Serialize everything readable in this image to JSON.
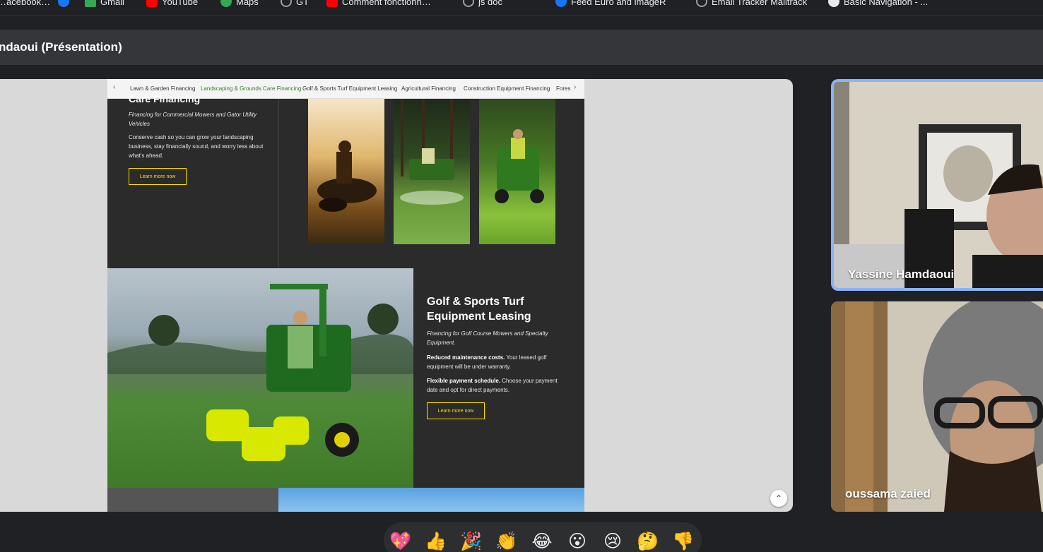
{
  "bookmarks": [
    {
      "label": "…acebook…",
      "color": "#1877f2"
    },
    {
      "label": "Gmail",
      "color": "#34a853"
    },
    {
      "label": "YouTube",
      "color": "#ff0000"
    },
    {
      "label": "Maps",
      "color": "#34a853"
    },
    {
      "label": "GT",
      "color": "#9aa0a6"
    },
    {
      "label": "Comment fonctionn…",
      "color": "#ff0000"
    },
    {
      "label": "js doc",
      "color": "#9aa0a6"
    },
    {
      "label": "Feed Euro and imageR",
      "color": "#1877f2"
    },
    {
      "label": "Email Tracker Mailtrack",
      "color": "#9aa0a6"
    },
    {
      "label": "Basic Navigation - ...",
      "color": "#e8eaed"
    }
  ],
  "meeting": {
    "presentation_title": "ndaoui (Présentation)"
  },
  "shared_page": {
    "tabs": [
      {
        "label": "Lawn & Garden Financing",
        "active": false
      },
      {
        "label": "Landscaping & Grounds Care Financing",
        "active": true
      },
      {
        "label": "Golf & Sports Turf Equipment Leasing",
        "active": false
      },
      {
        "label": "Agricultural Financing",
        "active": false
      },
      {
        "label": "Construction Equipment Financing",
        "active": false
      },
      {
        "label": "Fores",
        "active": false
      }
    ],
    "tab_prev": "‹",
    "tab_next": "›",
    "landscaping": {
      "title": "Care Financing",
      "subtitle": "Financing for Commercial Mowers and Gator Utility Vehicles",
      "body": "Conserve cash so you can grow your landscaping business, stay financially sound, and worry less about what's ahead.",
      "cta": "Learn more now"
    },
    "golf": {
      "title": "Golf & Sports Turf Equipment Leasing",
      "subtitle": "Financing for Golf Course Mowers and Specialty Equipment.",
      "p1_bold": "Reduced maintenance costs.",
      "p1_text": " Your leased golf equipment will be under warranty.",
      "p2_bold": "Flexible payment schedule.",
      "p2_text": " Choose your payment date and opt for direct payments.",
      "cta": "Learn more now"
    },
    "scroll_up": "⌃"
  },
  "participants": [
    {
      "name": "Yassine Hamdaoui",
      "active_speaker": true
    },
    {
      "name": "oussama zaied",
      "active_speaker": false
    }
  ],
  "reactions": [
    "💖",
    "👍",
    "🎉",
    "👏",
    "😂",
    "😮",
    "😢",
    "🤔",
    "👎"
  ],
  "colors": {
    "accent_yellow": "#ffde00",
    "active_tab_green": "#367c2b",
    "speaker_border": "#8ab4f8"
  }
}
